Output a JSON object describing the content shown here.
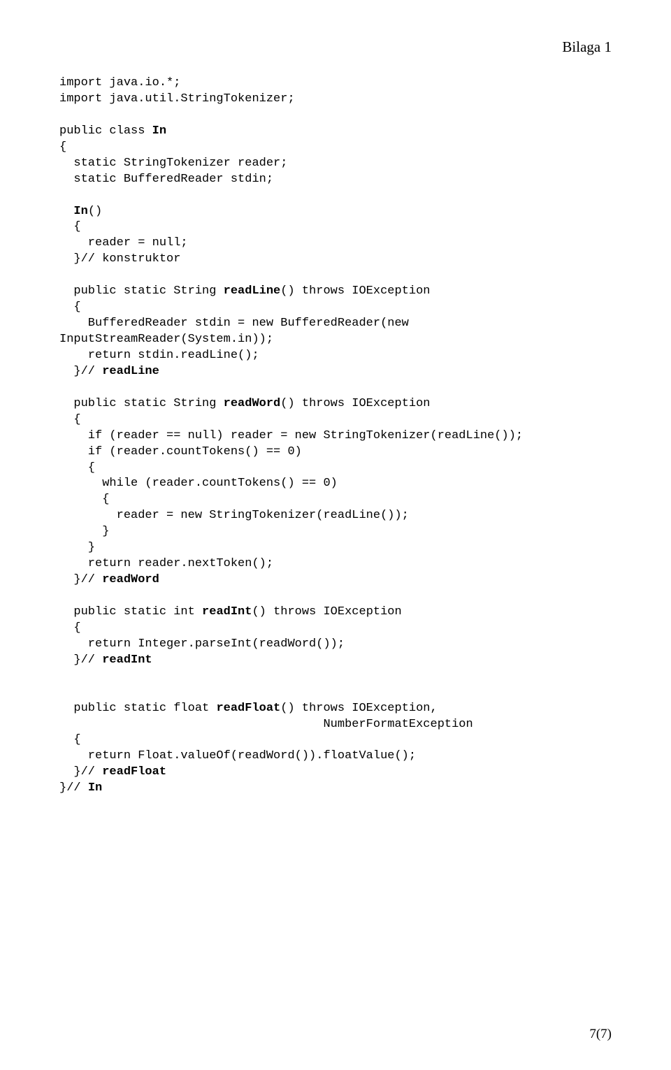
{
  "header": "Bilaga 1",
  "footer": "7(7)",
  "c": {
    "l01a": "import java.io.*;",
    "l02a": "import java.util.StringTokenizer;",
    "l03a": "public class ",
    "l03b": "In",
    "l04a": "{",
    "l05a": "  static StringTokenizer reader;",
    "l06a": "  static BufferedReader stdin;",
    "l07a": "  ",
    "l07b": "In",
    "l07c": "()",
    "l08a": "  {",
    "l09a": "    reader = null;",
    "l10a": "  }// konstruktor",
    "l11a": "  public static String ",
    "l11b": "readLine",
    "l11c": "() throws IOException",
    "l12a": "  {",
    "l13a": "    BufferedReader stdin = new BufferedReader(new",
    "l14a": "InputStreamReader(System.in));",
    "l15a": "    return stdin.readLine();",
    "l16a": "  }// ",
    "l16b": "readLine",
    "l17a": "  public static String ",
    "l17b": "readWord",
    "l17c": "() throws IOException",
    "l18a": "  {",
    "l19a": "    if (reader == null) reader = new StringTokenizer(readLine());",
    "l20a": "    if (reader.countTokens() == 0)",
    "l21a": "    {",
    "l22a": "      while (reader.countTokens() == 0)",
    "l23a": "      {",
    "l24a": "        reader = new StringTokenizer(readLine());",
    "l25a": "      }",
    "l26a": "    }",
    "l27a": "    return reader.nextToken();",
    "l28a": "  }// ",
    "l28b": "readWord",
    "l29a": "  public static int ",
    "l29b": "readInt",
    "l29c": "() throws IOException",
    "l30a": "  {",
    "l31a": "    return Integer.parseInt(readWord());",
    "l32a": "  }// ",
    "l32b": "readInt",
    "l33a": "  public static float ",
    "l33b": "readFloat",
    "l33c": "() throws IOException,",
    "l34a": "                                     NumberFormatException",
    "l35a": "  {",
    "l36a": "    return Float.valueOf(readWord()).floatValue();",
    "l37a": "  }// ",
    "l37b": "readFloat",
    "l38a": "}// ",
    "l38b": "In"
  }
}
